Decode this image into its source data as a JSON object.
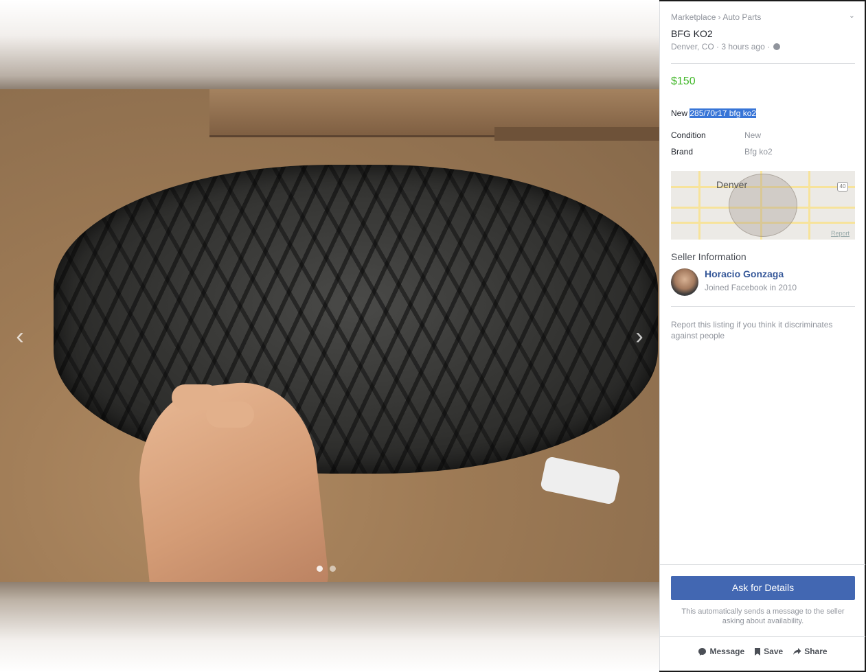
{
  "breadcrumb": {
    "marketplace": "Marketplace",
    "separator": "›",
    "category": "Auto Parts"
  },
  "listing": {
    "title": "BFG KO2",
    "location": "Denver, CO",
    "time": "3 hours ago",
    "dot": "·",
    "price": "$150",
    "description_prefix": "New",
    "description_highlight": "285/70r17 bfg ko2",
    "attributes": [
      {
        "key": "Condition",
        "value": "New"
      },
      {
        "key": "Brand",
        "value": "Bfg ko2"
      }
    ]
  },
  "map": {
    "city_label": "Denver",
    "shield": "40",
    "report_link": "Report"
  },
  "seller": {
    "heading": "Seller Information",
    "name": "Horacio Gonzaga",
    "joined": "Joined Facebook in 2010"
  },
  "report_text": "Report this listing if you think it discriminates against people",
  "actions": {
    "ask_button": "Ask for Details",
    "auto_note": "This automatically sends a message to the seller asking about availability.",
    "message": "Message",
    "save": "Save",
    "share": "Share"
  },
  "icons": {
    "prev": "‹",
    "next": "›",
    "chevron": "⌄",
    "message_icon": "message-bubble-icon",
    "save_icon": "bookmark-icon",
    "share_icon": "share-arrow-icon"
  },
  "colors": {
    "price": "#42b72a",
    "button": "#4267b2",
    "link": "#365899",
    "highlight": "#3875d7"
  },
  "photo": {
    "count": 2,
    "active_index": 0
  }
}
